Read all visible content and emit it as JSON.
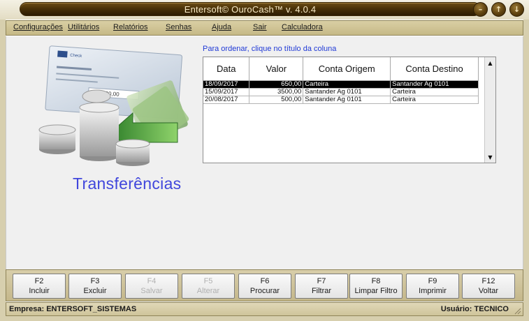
{
  "window": {
    "title": "Entersoft© OuroCash™ v. 4.0.4",
    "controls": [
      {
        "name": "minimize-button",
        "glyph": "–"
      },
      {
        "name": "maximize-button",
        "glyph": "↑"
      },
      {
        "name": "close-button",
        "glyph": "↓"
      }
    ]
  },
  "menu": [
    {
      "label": "Configurações"
    },
    {
      "label": "Utilitários"
    },
    {
      "label": "Relatórios"
    },
    {
      "label": "Senhas"
    },
    {
      "label": "Ajuda"
    },
    {
      "label": "Sair"
    },
    {
      "label": "Calculadora"
    }
  ],
  "main": {
    "hint": "Para ordenar, clique no título da coluna",
    "section_title": "Transferências",
    "illustration": {
      "icon": "check-and-coins-transfer-icon",
      "check_amount": "000.000,00",
      "check_brand": "Check"
    },
    "table": {
      "columns": [
        "Data",
        "Valor",
        "Conta Origem",
        "Conta Destino"
      ],
      "rows": [
        {
          "data": "18/09/2017",
          "valor": "650,00",
          "origem": "Carteira",
          "destino": "Santander Ag 0101",
          "selected": true
        },
        {
          "data": "15/09/2017",
          "valor": "3500,00",
          "origem": "Santander Ag 0101",
          "destino": "Carteira",
          "selected": false
        },
        {
          "data": "20/08/2017",
          "valor": "500,00",
          "origem": "Santander Ag 0101",
          "destino": "Carteira",
          "selected": false
        }
      ]
    }
  },
  "function_keys": [
    {
      "key": "F2",
      "label": "Incluir",
      "enabled": true
    },
    {
      "key": "F3",
      "label": "Excluir",
      "enabled": true
    },
    {
      "key": "F4",
      "label": "Salvar",
      "enabled": false
    },
    {
      "key": "F5",
      "label": "Alterar",
      "enabled": false
    },
    {
      "key": "F6",
      "label": "Procurar",
      "enabled": true
    },
    {
      "key": "F7",
      "label": "Filtrar",
      "enabled": true
    },
    {
      "key": "F8",
      "label": "Limpar Filtro",
      "enabled": true
    },
    {
      "key": "F9",
      "label": "Imprimir",
      "enabled": true
    },
    {
      "key": "F12",
      "label": "Voltar",
      "enabled": true
    }
  ],
  "status": {
    "empresa": "Empresa: ENTERSOFT_SISTEMAS",
    "usuario": "Usuário: TECNICO"
  },
  "colors": {
    "title_bar": "#4a3208",
    "menu_bar": "#d9cfa4",
    "accent_text": "#4046dc",
    "hint_text": "#1f39d6",
    "selection": "#000000"
  }
}
